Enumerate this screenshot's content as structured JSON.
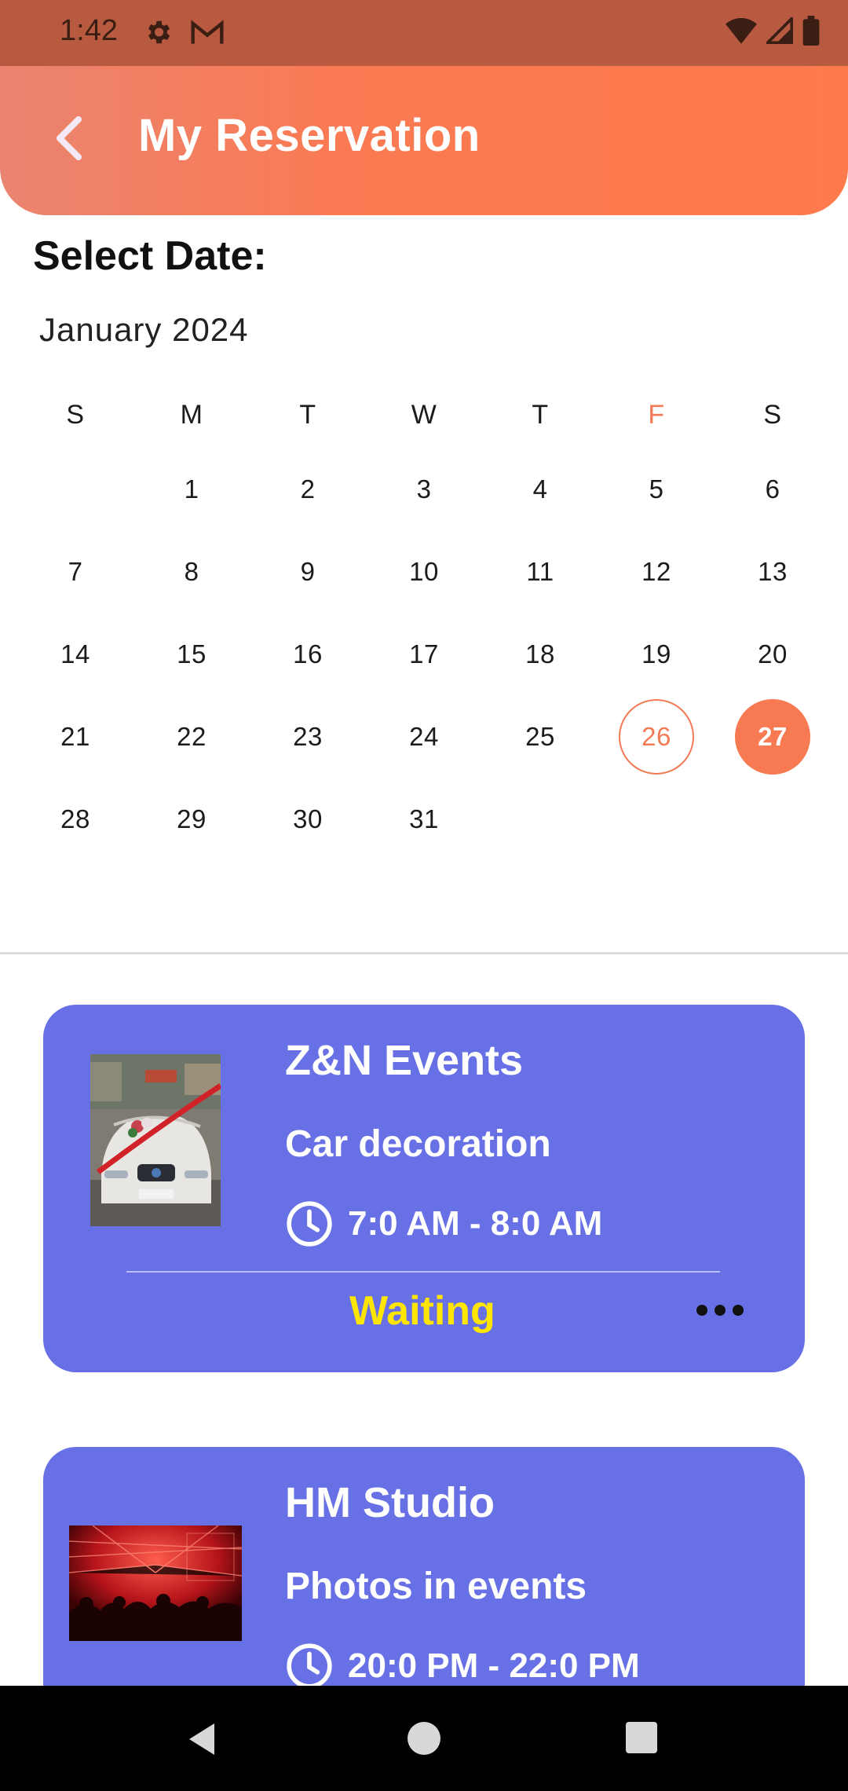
{
  "status_bar": {
    "time": "1:42",
    "left_icons": [
      "gear-icon",
      "gmail-icon"
    ],
    "right_icons": [
      "wifi-icon",
      "signal-icon",
      "battery-icon"
    ]
  },
  "header": {
    "title": "My Reservation",
    "back_icon": "chevron-left-icon",
    "gradient_colors": [
      "#ea8470",
      "#ff7a4b"
    ]
  },
  "calendar": {
    "label": "Select Date:",
    "month": "January 2024",
    "weekdays": [
      "S",
      "M",
      "T",
      "W",
      "T",
      "F",
      "S"
    ],
    "highlight_weekday_index": 5,
    "weeks": [
      [
        "",
        "1",
        "2",
        "3",
        "4",
        "5",
        "6"
      ],
      [
        "7",
        "8",
        "9",
        "10",
        "11",
        "12",
        "13"
      ],
      [
        "14",
        "15",
        "16",
        "17",
        "18",
        "19",
        "20"
      ],
      [
        "21",
        "22",
        "23",
        "24",
        "25",
        "26",
        "27"
      ],
      [
        "28",
        "29",
        "30",
        "31",
        "",
        "",
        ""
      ]
    ],
    "today": "26",
    "selected": "27",
    "accent_color": "#f87a52"
  },
  "reservations": [
    {
      "provider": "Z&N Events",
      "service": "Car decoration",
      "time": "7:0 AM - 8:0 AM",
      "status": "Waiting",
      "thumbnail": "car-decoration-photo",
      "time_icon": "clock-icon",
      "more_icon": "more-horizontal-icon"
    },
    {
      "provider": "HM Studio",
      "service": "Photos in events",
      "time": "20:0 PM - 22:0 PM",
      "thumbnail": "concert-photo",
      "time_icon": "clock-icon"
    }
  ],
  "colors": {
    "card_bg": "#6870e6",
    "status_waiting": "#ffe600"
  },
  "nav_bar": {
    "buttons": [
      "back-nav-icon",
      "home-nav-icon",
      "recents-nav-icon"
    ]
  }
}
